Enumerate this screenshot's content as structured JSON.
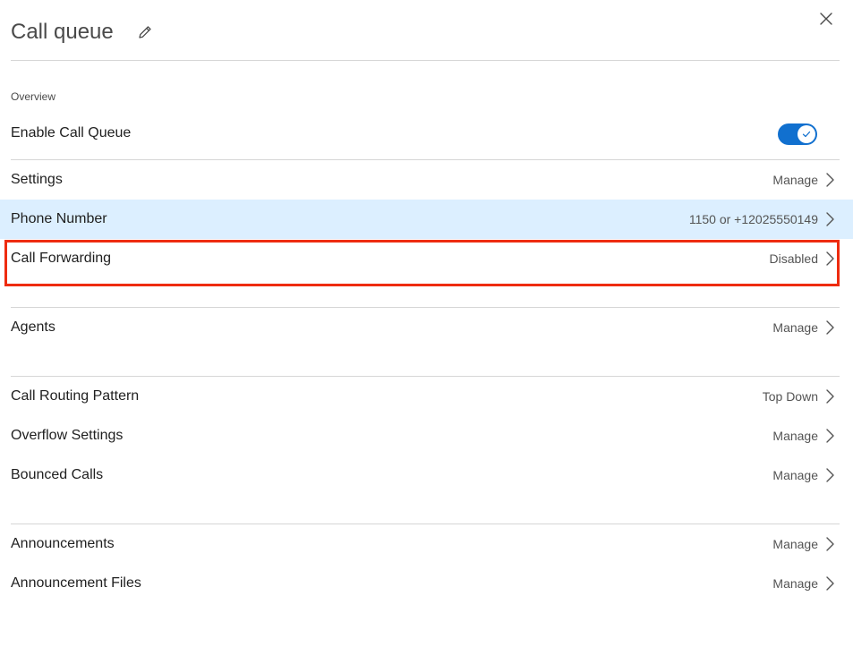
{
  "header": {
    "title": "Call queue",
    "edit_icon": "pencil-icon",
    "close_icon": "close-icon"
  },
  "overview": {
    "section_label": "Overview",
    "enable_label": "Enable Call Queue",
    "enable_state": true
  },
  "rows": {
    "settings": {
      "label": "Settings",
      "value": "Manage"
    },
    "phone_number": {
      "label": "Phone Number",
      "value": "1150 or +12025550149"
    },
    "call_forwarding": {
      "label": "Call Forwarding",
      "value": "Disabled"
    },
    "agents": {
      "label": "Agents",
      "value": "Manage"
    },
    "call_routing_pattern": {
      "label": "Call Routing Pattern",
      "value": "Top Down"
    },
    "overflow_settings": {
      "label": "Overflow Settings",
      "value": "Manage"
    },
    "bounced_calls": {
      "label": "Bounced Calls",
      "value": "Manage"
    },
    "announcements": {
      "label": "Announcements",
      "value": "Manage"
    },
    "announcement_files": {
      "label": "Announcement Files",
      "value": "Manage"
    }
  },
  "colors": {
    "accent": "#1170cf",
    "selected_row": "#dcefff",
    "highlight": "#ee2c10"
  }
}
